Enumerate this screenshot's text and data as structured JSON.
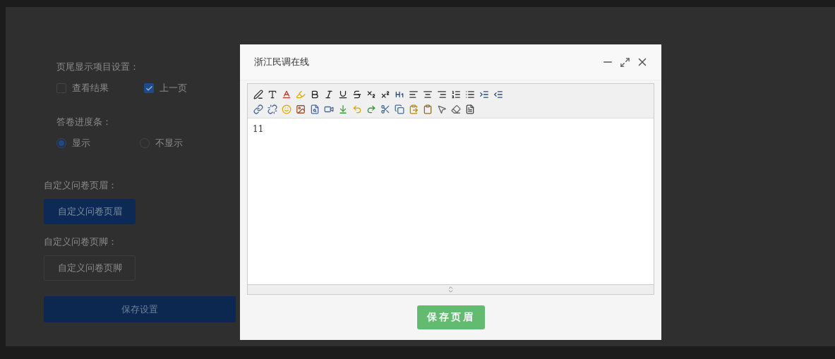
{
  "settings": {
    "footer_label": "页尾显示项目设置：",
    "footer_options": [
      {
        "label": "查看结果",
        "checked": false
      },
      {
        "label": "上一页",
        "checked": true
      }
    ],
    "progress_label": "答卷进度条：",
    "progress_options": [
      {
        "label": "显示",
        "selected": true
      },
      {
        "label": "不显示",
        "selected": false
      }
    ],
    "header_label": "自定义问卷页眉：",
    "header_button": "自定义问卷页眉",
    "footer_custom_label": "自定义问卷页脚：",
    "footer_button": "自定义问卷页脚",
    "save_button": "保存设置"
  },
  "dialog": {
    "title": "浙江民调在线",
    "editor_text": "11",
    "save_button": "保存页眉"
  }
}
